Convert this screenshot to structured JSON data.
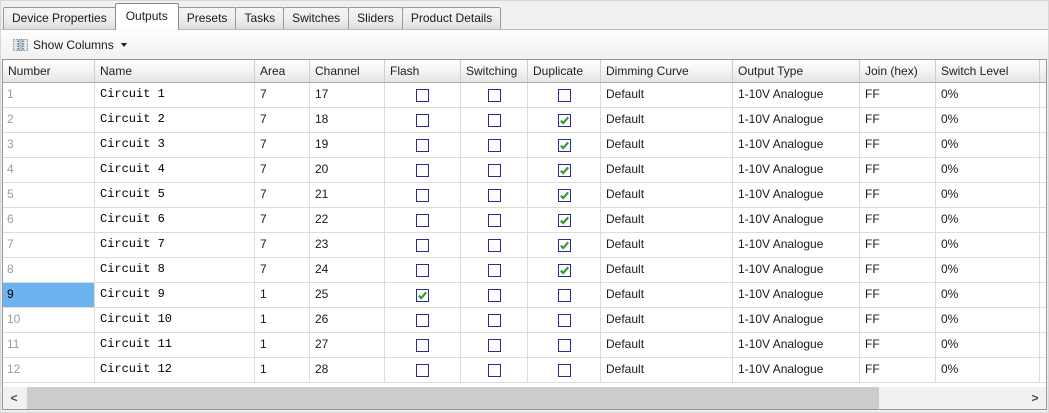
{
  "tabs": [
    {
      "label": "Device Properties",
      "active": false
    },
    {
      "label": "Outputs",
      "active": true
    },
    {
      "label": "Presets",
      "active": false
    },
    {
      "label": "Tasks",
      "active": false
    },
    {
      "label": "Switches",
      "active": false
    },
    {
      "label": "Sliders",
      "active": false
    },
    {
      "label": "Product Details",
      "active": false
    }
  ],
  "toolbar": {
    "show_columns_label": "Show Columns",
    "icon": "columns-icon"
  },
  "table": {
    "columns": [
      {
        "key": "number",
        "label": "Number",
        "width": 92,
        "type": "text"
      },
      {
        "key": "name",
        "label": "Name",
        "width": 160,
        "type": "text"
      },
      {
        "key": "area",
        "label": "Area",
        "width": 55,
        "type": "text"
      },
      {
        "key": "channel",
        "label": "Channel",
        "width": 75,
        "type": "text"
      },
      {
        "key": "flash",
        "label": "Flash",
        "width": 76,
        "type": "checkbox"
      },
      {
        "key": "switching",
        "label": "Switching",
        "width": 67,
        "type": "checkbox"
      },
      {
        "key": "duplicate",
        "label": "Duplicate",
        "width": 73,
        "type": "checkbox"
      },
      {
        "key": "dimming_curve",
        "label": "Dimming Curve",
        "width": 132,
        "type": "text"
      },
      {
        "key": "output_type",
        "label": "Output Type",
        "width": 127,
        "type": "text"
      },
      {
        "key": "join_hex",
        "label": "Join (hex)",
        "width": 76,
        "type": "text"
      },
      {
        "key": "switch_level",
        "label": "Switch Level",
        "width": 104,
        "type": "text"
      }
    ],
    "rows": [
      {
        "number": "1",
        "name": "Circuit 1",
        "area": "7",
        "channel": "17",
        "flash": false,
        "switching": false,
        "duplicate": false,
        "dimming_curve": "Default",
        "output_type": "1-10V Analogue",
        "join_hex": "FF",
        "switch_level": "0%",
        "selected": false
      },
      {
        "number": "2",
        "name": "Circuit 2",
        "area": "7",
        "channel": "18",
        "flash": false,
        "switching": false,
        "duplicate": true,
        "dimming_curve": "Default",
        "output_type": "1-10V Analogue",
        "join_hex": "FF",
        "switch_level": "0%",
        "selected": false
      },
      {
        "number": "3",
        "name": "Circuit 3",
        "area": "7",
        "channel": "19",
        "flash": false,
        "switching": false,
        "duplicate": true,
        "dimming_curve": "Default",
        "output_type": "1-10V Analogue",
        "join_hex": "FF",
        "switch_level": "0%",
        "selected": false
      },
      {
        "number": "4",
        "name": "Circuit 4",
        "area": "7",
        "channel": "20",
        "flash": false,
        "switching": false,
        "duplicate": true,
        "dimming_curve": "Default",
        "output_type": "1-10V Analogue",
        "join_hex": "FF",
        "switch_level": "0%",
        "selected": false
      },
      {
        "number": "5",
        "name": "Circuit 5",
        "area": "7",
        "channel": "21",
        "flash": false,
        "switching": false,
        "duplicate": true,
        "dimming_curve": "Default",
        "output_type": "1-10V Analogue",
        "join_hex": "FF",
        "switch_level": "0%",
        "selected": false
      },
      {
        "number": "6",
        "name": "Circuit 6",
        "area": "7",
        "channel": "22",
        "flash": false,
        "switching": false,
        "duplicate": true,
        "dimming_curve": "Default",
        "output_type": "1-10V Analogue",
        "join_hex": "FF",
        "switch_level": "0%",
        "selected": false
      },
      {
        "number": "7",
        "name": "Circuit 7",
        "area": "7",
        "channel": "23",
        "flash": false,
        "switching": false,
        "duplicate": true,
        "dimming_curve": "Default",
        "output_type": "1-10V Analogue",
        "join_hex": "FF",
        "switch_level": "0%",
        "selected": false
      },
      {
        "number": "8",
        "name": "Circuit 8",
        "area": "7",
        "channel": "24",
        "flash": false,
        "switching": false,
        "duplicate": true,
        "dimming_curve": "Default",
        "output_type": "1-10V Analogue",
        "join_hex": "FF",
        "switch_level": "0%",
        "selected": false
      },
      {
        "number": "9",
        "name": "Circuit 9",
        "area": "1",
        "channel": "25",
        "flash": true,
        "switching": false,
        "duplicate": false,
        "dimming_curve": "Default",
        "output_type": "1-10V Analogue",
        "join_hex": "FF",
        "switch_level": "0%",
        "selected": true
      },
      {
        "number": "10",
        "name": "Circuit 10",
        "area": "1",
        "channel": "26",
        "flash": false,
        "switching": false,
        "duplicate": false,
        "dimming_curve": "Default",
        "output_type": "1-10V Analogue",
        "join_hex": "FF",
        "switch_level": "0%",
        "selected": false
      },
      {
        "number": "11",
        "name": "Circuit 11",
        "area": "1",
        "channel": "27",
        "flash": false,
        "switching": false,
        "duplicate": false,
        "dimming_curve": "Default",
        "output_type": "1-10V Analogue",
        "join_hex": "FF",
        "switch_level": "0%",
        "selected": false
      },
      {
        "number": "12",
        "name": "Circuit 12",
        "area": "1",
        "channel": "28",
        "flash": false,
        "switching": false,
        "duplicate": false,
        "dimming_curve": "Default",
        "output_type": "1-10V Analogue",
        "join_hex": "FF",
        "switch_level": "0%",
        "selected": false
      }
    ],
    "selection": {
      "row_number": "9",
      "column": "number"
    }
  },
  "scrollbar": {
    "left_arrow": "<",
    "right_arrow": ">"
  },
  "colors": {
    "selection_blue": "#6CB4F0",
    "checkbox_border_navy": "#2B2B9E",
    "check_green": "#2F9E2F"
  }
}
